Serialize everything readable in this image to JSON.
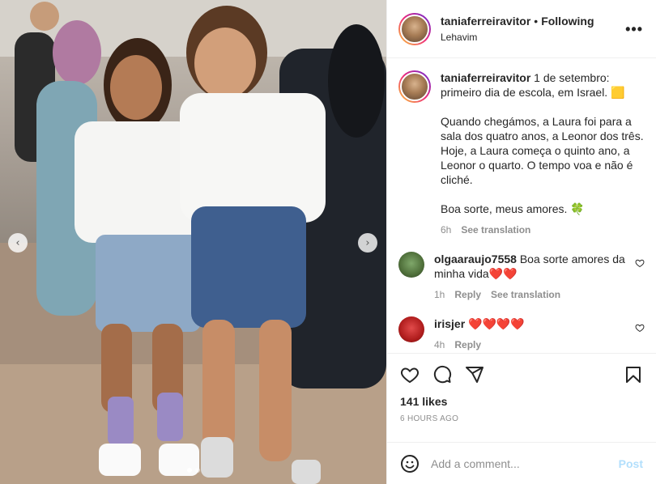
{
  "post": {
    "username": "taniaferreiravitor",
    "separator": "•",
    "follow_status": "Following",
    "location": "Lehavim",
    "more_label": "•••"
  },
  "caption": {
    "username": "taniaferreiravitor",
    "text": "1 de setembro: primeiro dia de escola, em Israel. 🟨\n\nQuando chegámos, a Laura foi para a sala dos quatro anos, a Leonor dos três. Hoje, a Laura começa o quinto ano, a Leonor o quarto. O tempo voa e não é cliché.\n\nBoa sorte, meus amores. 🍀",
    "time": "6h",
    "see_translation": "See translation"
  },
  "comments": [
    {
      "username": "olgaaraujo7558",
      "text": "Boa sorte amores da minha vida",
      "hearts": "❤️❤️",
      "time": "1h",
      "reply": "Reply",
      "see_translation": "See translation"
    },
    {
      "username": "irisjer",
      "text": "",
      "hearts": "❤️❤️❤️❤️",
      "time": "4h",
      "reply": "Reply"
    }
  ],
  "engagement": {
    "likes": "141 likes",
    "posted": "6 HOURS AGO"
  },
  "composer": {
    "placeholder": "Add a comment...",
    "post_label": "Post"
  },
  "carousel": {
    "prev_label": "‹",
    "next_label": "›",
    "slide_count": 2,
    "active_index": 0
  },
  "colors": {
    "border": "#efefef",
    "muted": "#8e8e8e",
    "post_disabled": "#b2dffc",
    "heart": "#ed1c24"
  }
}
